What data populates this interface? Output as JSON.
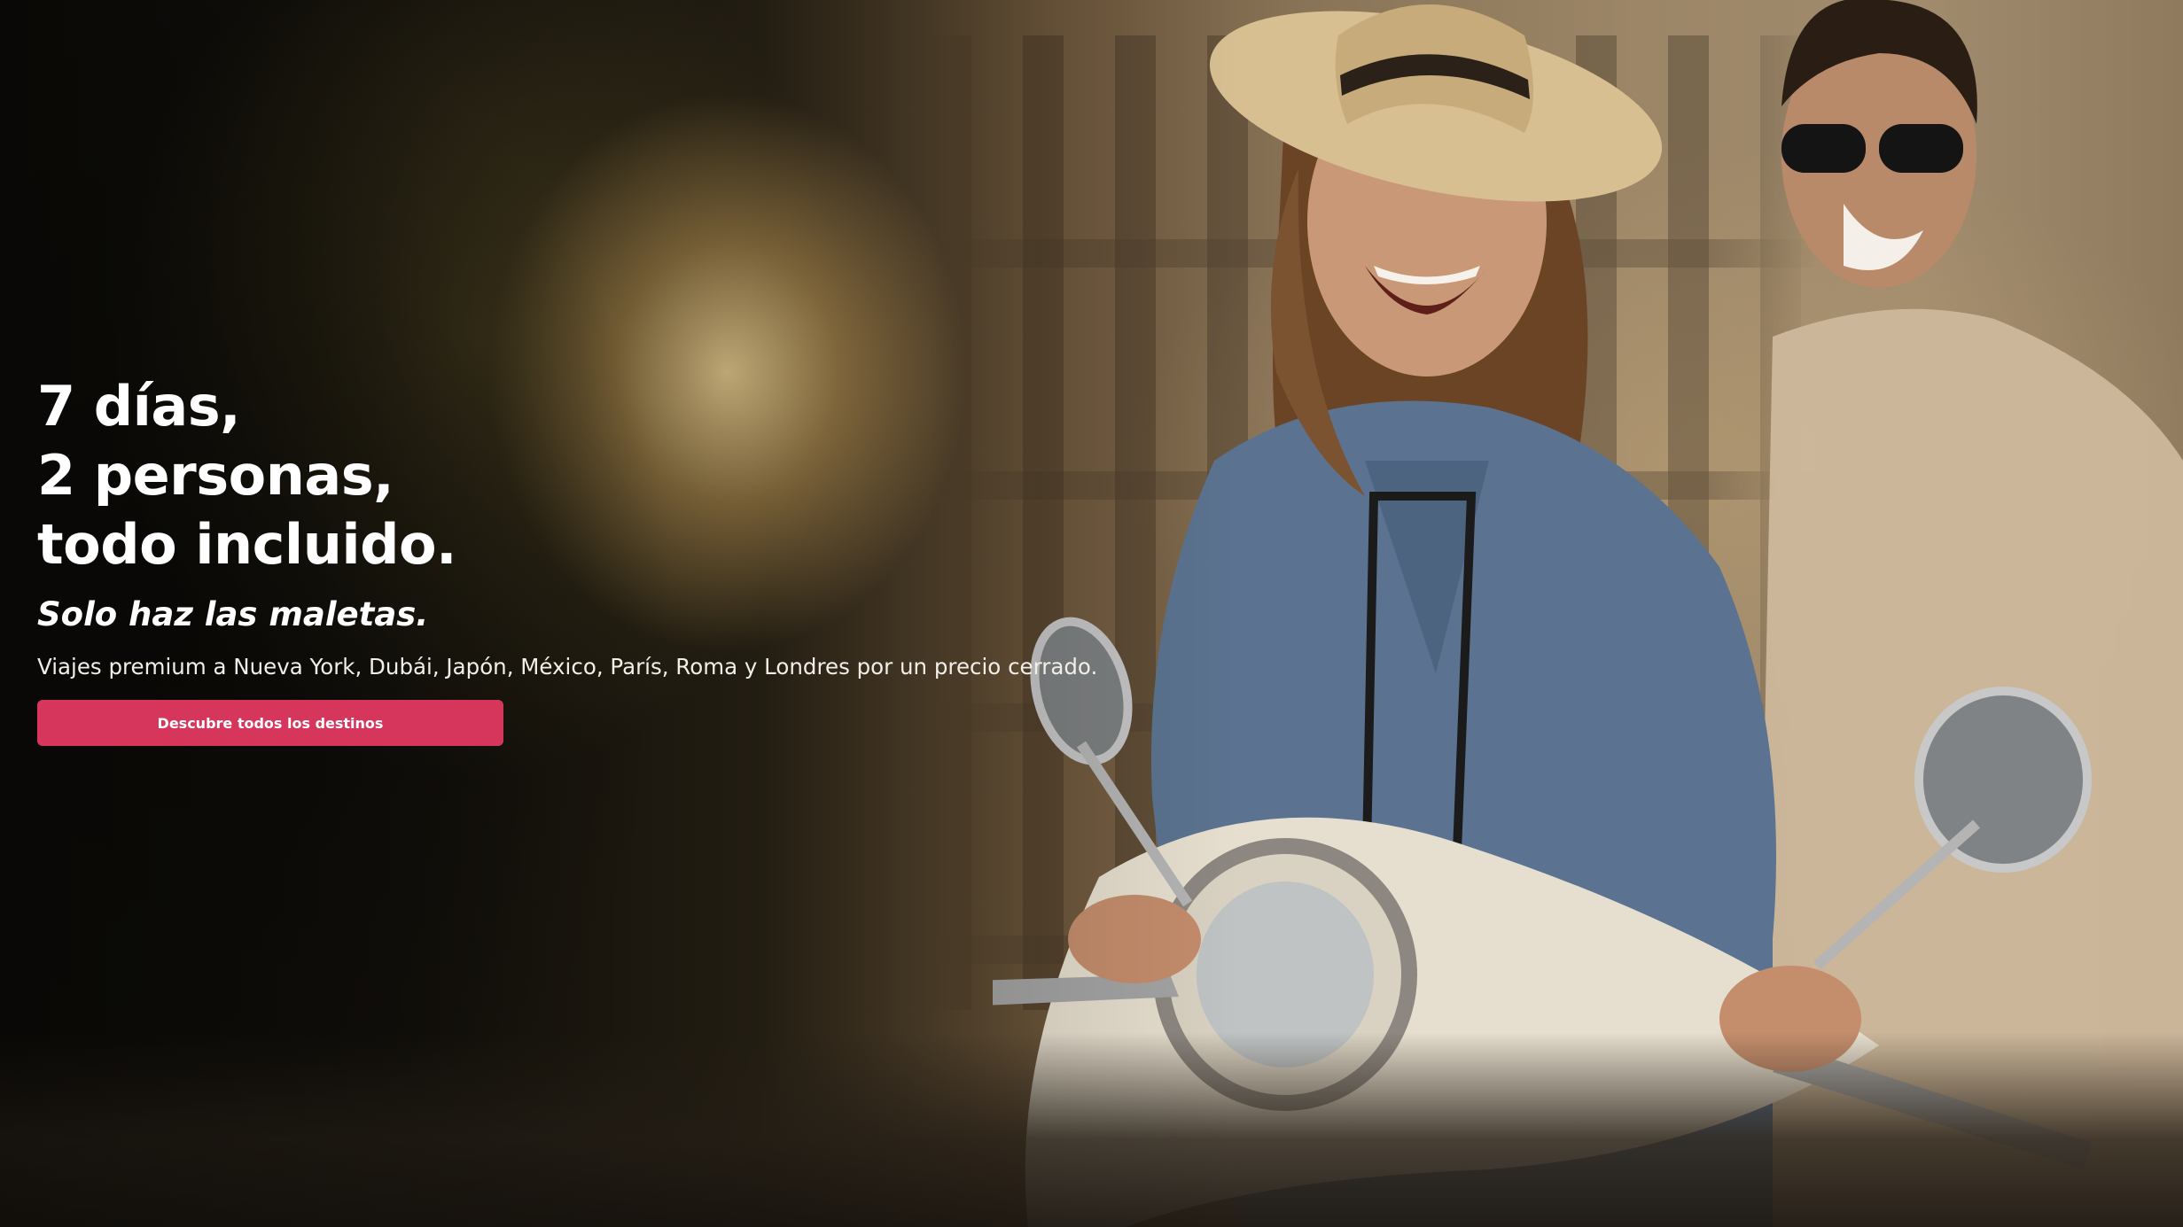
{
  "hero": {
    "headline_lines": [
      "7 días,",
      "2 personas,",
      "todo incluido."
    ],
    "tagline": "Solo haz las maletas.",
    "subtext": "Viajes premium a Nueva York, Dubái, Japón, México, París, Roma y Londres por un precio cerrado.",
    "cta_label": "Descubre todos los destinos",
    "colors": {
      "cta_background": "#d6365b",
      "text": "#ffffff"
    }
  }
}
